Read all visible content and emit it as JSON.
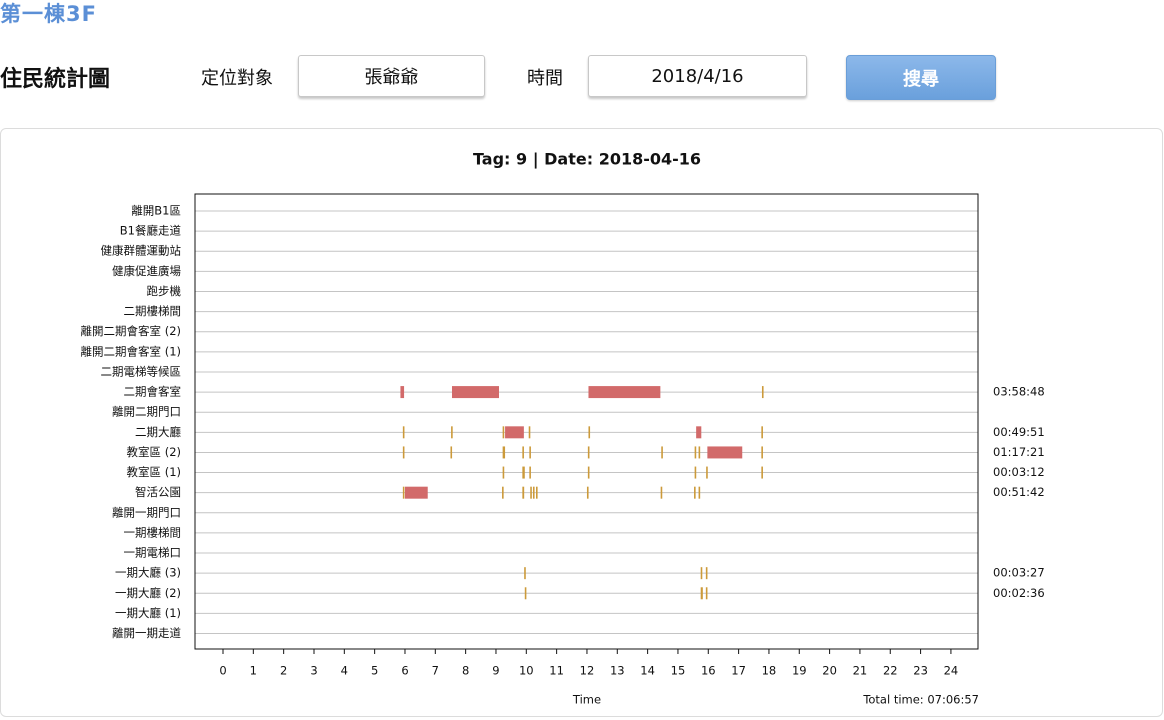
{
  "building_title": "第一棟3F",
  "page_title": "住民統計圖",
  "filters": {
    "target_label": "定位對象",
    "target_value": "張爺爺",
    "time_label": "時間",
    "time_value": "2018/4/16",
    "search_label": "搜尋"
  },
  "chart_data": {
    "type": "timeline",
    "title": "Tag: 9 | Date: 2018-04-16",
    "xlabel": "Time",
    "total_time": "Total time: 07:06:57",
    "xlim": [
      0,
      24
    ],
    "xticks": [
      0,
      1,
      2,
      3,
      4,
      5,
      6,
      7,
      8,
      9,
      10,
      11,
      12,
      13,
      14,
      15,
      16,
      17,
      18,
      19,
      20,
      21,
      22,
      23,
      24
    ],
    "grid": true,
    "series_color": "#d26a6a",
    "mark_color": "#cc9a3a",
    "rows": [
      {
        "label": "離開B1區",
        "duration": "",
        "segments": []
      },
      {
        "label": "B1餐廳走道",
        "duration": "",
        "segments": []
      },
      {
        "label": "健康群體運動站",
        "duration": "",
        "segments": []
      },
      {
        "label": "健康促進廣場",
        "duration": "",
        "segments": []
      },
      {
        "label": "跑步機",
        "duration": "",
        "segments": []
      },
      {
        "label": "二期樓梯間",
        "duration": "",
        "segments": []
      },
      {
        "label": "離開二期會客室 (2)",
        "duration": "",
        "segments": []
      },
      {
        "label": "離開二期會客室 (1)",
        "duration": "",
        "segments": []
      },
      {
        "label": "二期電梯等候區",
        "duration": "",
        "segments": []
      },
      {
        "label": "二期會客室",
        "duration": "03:58:48",
        "segments": [
          [
            5.85,
            5.97
          ],
          [
            7.55,
            9.1
          ],
          [
            12.05,
            14.42
          ],
          [
            17.77,
            17.79
          ]
        ]
      },
      {
        "label": "離開二期門口",
        "duration": "",
        "segments": []
      },
      {
        "label": "二期大廳",
        "duration": "00:49:51",
        "segments": [
          [
            5.93,
            5.95
          ],
          [
            7.52,
            7.57
          ],
          [
            9.22,
            9.27
          ],
          [
            9.3,
            9.92
          ],
          [
            10.08,
            10.13
          ],
          [
            12.05,
            12.1
          ],
          [
            15.6,
            15.77
          ],
          [
            17.75,
            17.8
          ]
        ]
      },
      {
        "label": "教室區 (2)",
        "duration": "01:17:21",
        "segments": [
          [
            5.93,
            5.95
          ],
          [
            7.5,
            7.52
          ],
          [
            9.22,
            9.3
          ],
          [
            9.87,
            9.92
          ],
          [
            10.1,
            10.13
          ],
          [
            12.03,
            12.05
          ],
          [
            14.45,
            14.47
          ],
          [
            15.55,
            15.6
          ],
          [
            15.68,
            15.72
          ],
          [
            15.97,
            17.12
          ],
          [
            17.75,
            17.77
          ]
        ]
      },
      {
        "label": "教室區 (1)",
        "duration": "00:03:12",
        "segments": [
          [
            9.22,
            9.24
          ],
          [
            9.87,
            9.95
          ],
          [
            10.1,
            10.13
          ],
          [
            12.03,
            12.05
          ],
          [
            15.55,
            15.57
          ],
          [
            15.93,
            15.95
          ],
          [
            17.75,
            17.77
          ]
        ]
      },
      {
        "label": "智活公園",
        "duration": "00:51:42",
        "segments": [
          [
            5.93,
            5.95
          ],
          [
            6.0,
            6.75
          ],
          [
            9.2,
            9.24
          ],
          [
            9.87,
            9.93
          ],
          [
            10.13,
            10.18
          ],
          [
            10.22,
            10.25
          ],
          [
            10.32,
            10.35
          ],
          [
            12.0,
            12.02
          ],
          [
            14.43,
            14.45
          ],
          [
            15.53,
            15.55
          ],
          [
            15.68,
            15.7
          ]
        ]
      },
      {
        "label": "離開一期門口",
        "duration": "",
        "segments": []
      },
      {
        "label": "一期樓梯間",
        "duration": "",
        "segments": []
      },
      {
        "label": "一期電梯口",
        "duration": "",
        "segments": []
      },
      {
        "label": "一期大廳 (3)",
        "duration": "00:03:27",
        "segments": [
          [
            9.93,
            9.98
          ],
          [
            15.75,
            15.8
          ],
          [
            15.92,
            15.94
          ]
        ]
      },
      {
        "label": "一期大廳 (2)",
        "duration": "00:02:36",
        "segments": [
          [
            9.95,
            9.98
          ],
          [
            15.75,
            15.82
          ],
          [
            15.92,
            15.95
          ]
        ]
      },
      {
        "label": "一期大廳 (1)",
        "duration": "",
        "segments": []
      },
      {
        "label": "離開一期走道",
        "duration": "",
        "segments": []
      }
    ]
  }
}
